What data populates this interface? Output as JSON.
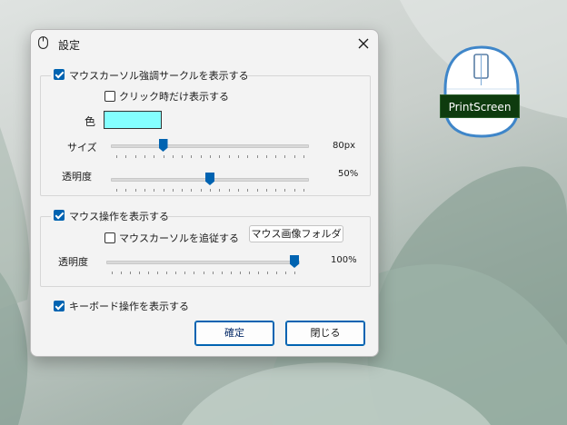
{
  "dialog": {
    "title": "設定",
    "close": "×"
  },
  "circle_group": {
    "checkbox_label": "マウスカーソル強調サークルを表示する",
    "checked": true,
    "click_only_label": "クリック時だけ表示する",
    "click_only_checked": false,
    "color_label": "色",
    "color_value": "#84ffff",
    "size_label": "サイズ",
    "size_value_text": "80px",
    "size_fraction": 0.25,
    "opacity_label": "透明度",
    "opacity_value_text": "50%",
    "opacity_fraction": 0.5
  },
  "mouse_group": {
    "checkbox_label": "マウス操作を表示する",
    "checked": true,
    "follow_label": "マウスカーソルを追従する",
    "follow_checked": false,
    "folder_button": "マウス画像フォルダ",
    "opacity_label": "透明度",
    "opacity_value_text": "100%",
    "opacity_fraction": 1.0
  },
  "keyboard": {
    "checkbox_label": "キーボード操作を表示する",
    "checked": true
  },
  "buttons": {
    "ok": "確定",
    "close": "閉じる"
  },
  "overlay": {
    "key_label": "PrintScreen"
  },
  "colors": {
    "accent": "#0063b1",
    "key_bg": "#0e3b0e"
  }
}
